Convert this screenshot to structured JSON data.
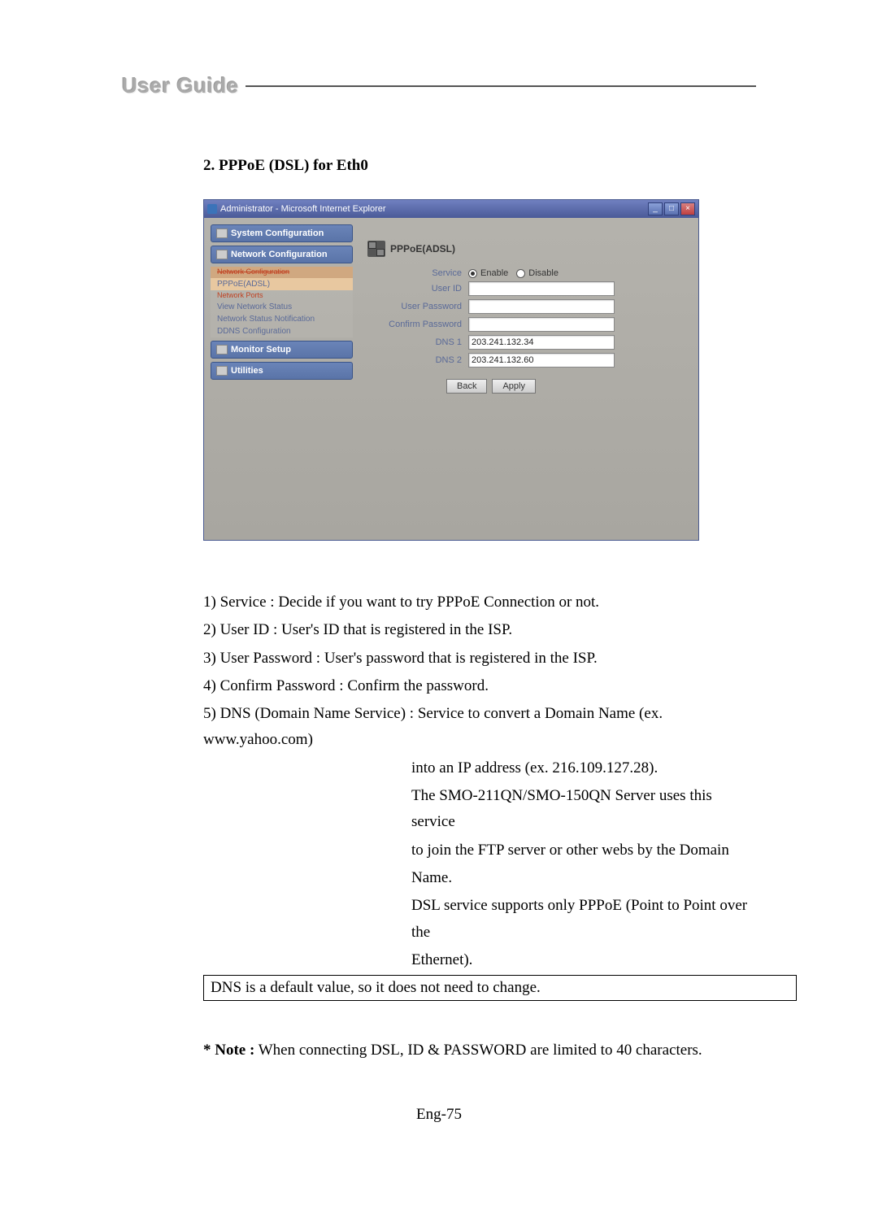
{
  "header": {
    "title": "User Guide"
  },
  "section": {
    "title": "2. PPPoE (DSL) for Eth0"
  },
  "screenshot": {
    "window_title": "Administrator - Microsoft Internet Explorer",
    "winbtn_min": "_",
    "winbtn_max": "□",
    "winbtn_close": "×",
    "sidebar": {
      "sys_conf": "System Configuration",
      "net_conf": "Network Configuration",
      "sub": {
        "top": "Network Configuration",
        "pppoe": "PPPoE(ADSL)",
        "ports": "Network Ports",
        "view_status": "View Network Status",
        "notif": "Network Status Notification",
        "ddns": "DDNS Configuration"
      },
      "monitor": "Monitor Setup",
      "utilities": "Utilities"
    },
    "content": {
      "heading": "PPPoE(ADSL)",
      "labels": {
        "service": "Service",
        "user_id": "User ID",
        "user_pw": "User Password",
        "confirm_pw": "Confirm Password",
        "dns1": "DNS 1",
        "dns2": "DNS 2"
      },
      "radios": {
        "enable": "Enable",
        "disable": "Disable"
      },
      "values": {
        "user_id": "",
        "user_pw": "",
        "confirm_pw": "",
        "dns1": "203.241.132.34",
        "dns2": "203.241.132.60"
      },
      "buttons": {
        "back": "Back",
        "apply": "Apply"
      }
    }
  },
  "body": {
    "l1": "1) Service : Decide if you want to try PPPoE Connection or not.",
    "l2": "2) User ID : User's ID that is registered in the ISP.",
    "l3": "3) User Password : User's password that is registered in the ISP.",
    "l4": "4) Confirm Password : Confirm the password.",
    "l5": "5) DNS (Domain Name Service) : Service to convert a Domain Name (ex. www.yahoo.com)",
    "l5a": "into an IP address (ex. 216.109.127.28).",
    "l5b": "The SMO-211QN/SMO-150QN Server uses this service",
    "l5c": "to join the FTP server or other webs by the Domain",
    "l5d": "Name.",
    "l5e": "DSL service supports only PPPoE (Point to Point over the",
    "l5f": "Ethernet)."
  },
  "boxed_note": "DNS is a default value, so it does not need to change.",
  "footnote": {
    "prefix": "* Note :",
    "text": " When connecting DSL, ID & PASSWORD are limited to 40 characters."
  },
  "page_num": "Eng-75"
}
